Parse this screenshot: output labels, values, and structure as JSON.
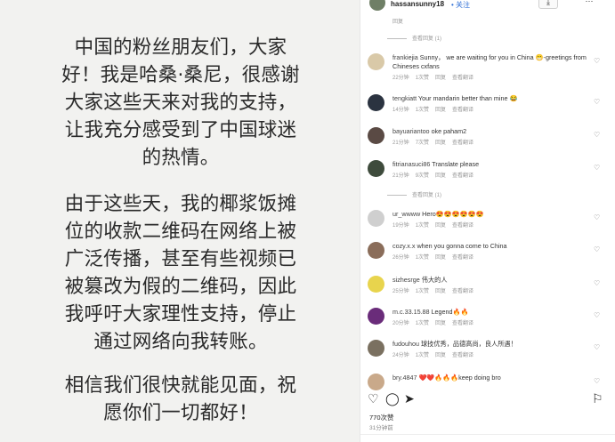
{
  "story": {
    "paragraphs": [
      "中国的粉丝朋友们，大家\n好！我是哈桑·桑尼，很感谢\n大家这些天来对我的支持，\n让我充分感受到了中国球迷\n的热情。",
      "由于这些天，我的椰浆饭摊\n位的收款二维码在网络上被\n广泛传播，甚至有些视频已\n被篡改为假的二维码，因此\n我呼吁大家理性支持，停止\n通过网络向我转账。",
      "相信我们很快就能见面，祝\n愿你们一切都好！"
    ]
  },
  "header": {
    "username": "hassansunny18",
    "follow_label": "• 关注",
    "save_icon": "download-icon",
    "more_icon": "more-icon",
    "more_glyph": "⋯",
    "save_glyph": "⤓"
  },
  "top_meta": "回复",
  "reply_label": "查看回复 (1)",
  "comments": [
    {
      "user": "frankiejia",
      "text": "Sunny， we are waiting for you in China 😁-greetings from Chineses cxfans",
      "time": "22分钟",
      "likes": "1次赞",
      "reply": "回复",
      "translate": "查看翻译",
      "color": "#d9c9a8"
    },
    {
      "user": "tengkiatt",
      "text": "Your mandarin better than mine 😂",
      "time": "14分钟",
      "likes": "1次赞",
      "reply": "回复",
      "translate": "查看翻译",
      "color": "#2b3340"
    },
    {
      "user": "bayuariantoo",
      "text": "oke paham2",
      "time": "21分钟",
      "likes": "7次赞",
      "reply": "回复",
      "translate": "查看翻译",
      "color": "#5a4a44"
    },
    {
      "user": "fitrianasuci86",
      "text": "Translate please",
      "time": "21分钟",
      "likes": "9次赞",
      "reply": "回复",
      "translate": "查看翻译",
      "color": "#3e4b3c"
    },
    {
      "user": "ur_wwww",
      "text": "Hero😍😍😍😍😍😍",
      "time": "19分钟",
      "likes": "1次赞",
      "reply": "回复",
      "translate": "查看翻译",
      "color": "#cfcfcf"
    },
    {
      "user": "cozy.x.x",
      "text": "when you gonna come to China",
      "time": "26分钟",
      "likes": "1次赞",
      "reply": "回复",
      "translate": "查看翻译",
      "color": "#8a6d5a"
    },
    {
      "user": "sizhesrge",
      "text": "伟大的人",
      "time": "25分钟",
      "likes": "1次赞",
      "reply": "回复",
      "translate": "查看翻译",
      "color": "#e8d44d"
    },
    {
      "user": "m.c.33.15.88",
      "text": "Legend🔥🔥",
      "time": "20分钟",
      "likes": "1次赞",
      "reply": "回复",
      "translate": "查看翻译",
      "color": "#6a2c7a"
    },
    {
      "user": "fudouhou",
      "text": "球技优秀，品德高尚，良人所遇！",
      "time": "24分钟",
      "likes": "1次赞",
      "reply": "回复",
      "translate": "查看翻译",
      "color": "#7a7060"
    },
    {
      "user": "bry.4847",
      "text": "❤️❤️🔥🔥🔥keep doing bro",
      "time": "",
      "likes": "",
      "reply": "",
      "translate": "",
      "color": "#c9a98a"
    }
  ],
  "actions": {
    "like": "♡",
    "comment": "◯",
    "share": "➤",
    "save": "⚐"
  },
  "likes_count": "770次赞",
  "post_time": "31分钟前"
}
